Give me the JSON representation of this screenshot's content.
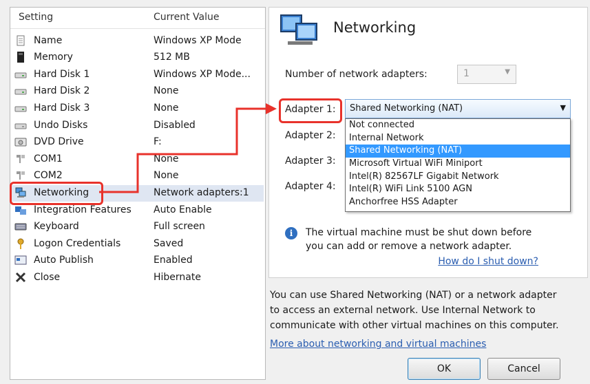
{
  "settings": {
    "header_setting": "Setting",
    "header_value": "Current Value",
    "rows": [
      {
        "label": "Name",
        "value": "Windows XP Mode",
        "icon": "name-icon"
      },
      {
        "label": "Memory",
        "value": "512 MB",
        "icon": "memory-icon"
      },
      {
        "label": "Hard Disk 1",
        "value": "Windows XP Mode...",
        "icon": "hard-disk-icon"
      },
      {
        "label": "Hard Disk 2",
        "value": "None",
        "icon": "hard-disk-icon"
      },
      {
        "label": "Hard Disk 3",
        "value": "None",
        "icon": "hard-disk-icon"
      },
      {
        "label": "Undo Disks",
        "value": "Disabled",
        "icon": "undo-disks-icon"
      },
      {
        "label": "DVD Drive",
        "value": "F:",
        "icon": "dvd-drive-icon"
      },
      {
        "label": "COM1",
        "value": "None",
        "icon": "com-port-icon"
      },
      {
        "label": "COM2",
        "value": "None",
        "icon": "com-port-icon"
      },
      {
        "label": "Networking",
        "value": "Network adapters:1",
        "icon": "networking-icon"
      },
      {
        "label": "Integration Features",
        "value": "Auto Enable",
        "icon": "integration-features-icon"
      },
      {
        "label": "Keyboard",
        "value": "Full screen",
        "icon": "keyboard-icon"
      },
      {
        "label": "Logon Credentials",
        "value": "Saved",
        "icon": "key-icon"
      },
      {
        "label": "Auto Publish",
        "value": "Enabled",
        "icon": "auto-publish-icon"
      },
      {
        "label": "Close",
        "value": "Hibernate",
        "icon": "close-icon"
      }
    ]
  },
  "networking": {
    "title": "Networking",
    "num_adapters_label": "Number of network adapters:",
    "num_adapters_value": "1",
    "adapter_labels": [
      "Adapter 1:",
      "Adapter 2:",
      "Adapter 3:",
      "Adapter 4:"
    ],
    "adapter1_value": "Shared Networking (NAT)",
    "dropdown_options": [
      "Not connected",
      "Internal Network",
      "Shared Networking (NAT)",
      "Microsoft Virtual WiFi Miniport",
      "Intel(R) 82567LF Gigabit Network",
      "Intel(R) WiFi Link 5100 AGN",
      "Anchorfree HSS Adapter"
    ],
    "info_line1": "The virtual machine must be shut down before",
    "info_line2": "you can add or remove a network adapter.",
    "shutdown_link": "How do I shut down?",
    "desc_line1": "You can use Shared Networking (NAT) or a network adapter",
    "desc_line2": "to access an external network. Use Internal Network to",
    "desc_line3": "communicate with other virtual machines on this computer.",
    "more_link": "More about networking and virtual machines"
  },
  "buttons": {
    "ok": "OK",
    "cancel": "Cancel"
  },
  "colors": {
    "callout": "#e8322b",
    "selection": "#3399ff",
    "link": "#2a5db0"
  }
}
